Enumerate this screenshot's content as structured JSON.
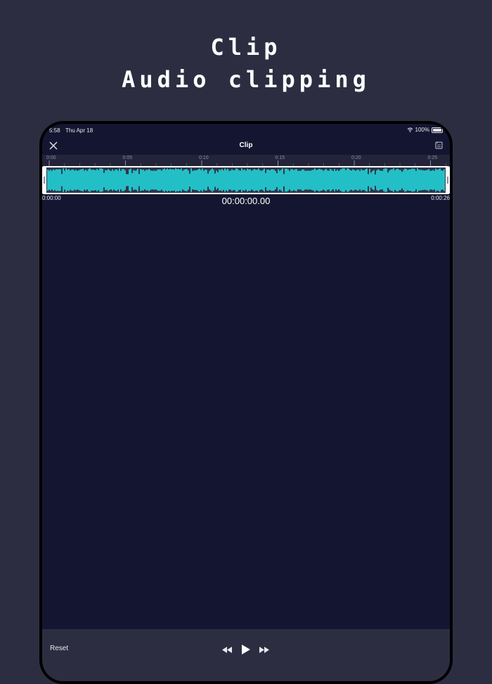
{
  "headline": {
    "line1": "Clip",
    "line2": "Audio clipping"
  },
  "status": {
    "time": "5:58",
    "date": "Thu Apr 18",
    "battery": "100%"
  },
  "nav": {
    "title": "Clip",
    "left_icon": "close-icon",
    "right_icon": "save-icon"
  },
  "ruler": {
    "labels": [
      "0:00",
      "0:05",
      "0:10",
      "0:15",
      "0:20",
      "0:25"
    ]
  },
  "clip": {
    "start_label": "0:00:00",
    "end_label": "0:00:26",
    "current_position": "00:00:00.00",
    "duration_seconds": 26
  },
  "toolbar": {
    "reset_label": "Reset",
    "controls": [
      "rewind-icon",
      "play-icon",
      "fast-forward-icon"
    ]
  },
  "colors": {
    "background": "#2d2d42",
    "screen": "#141631",
    "waveform": "#22c0c6",
    "waveform_track": "#33344a"
  }
}
